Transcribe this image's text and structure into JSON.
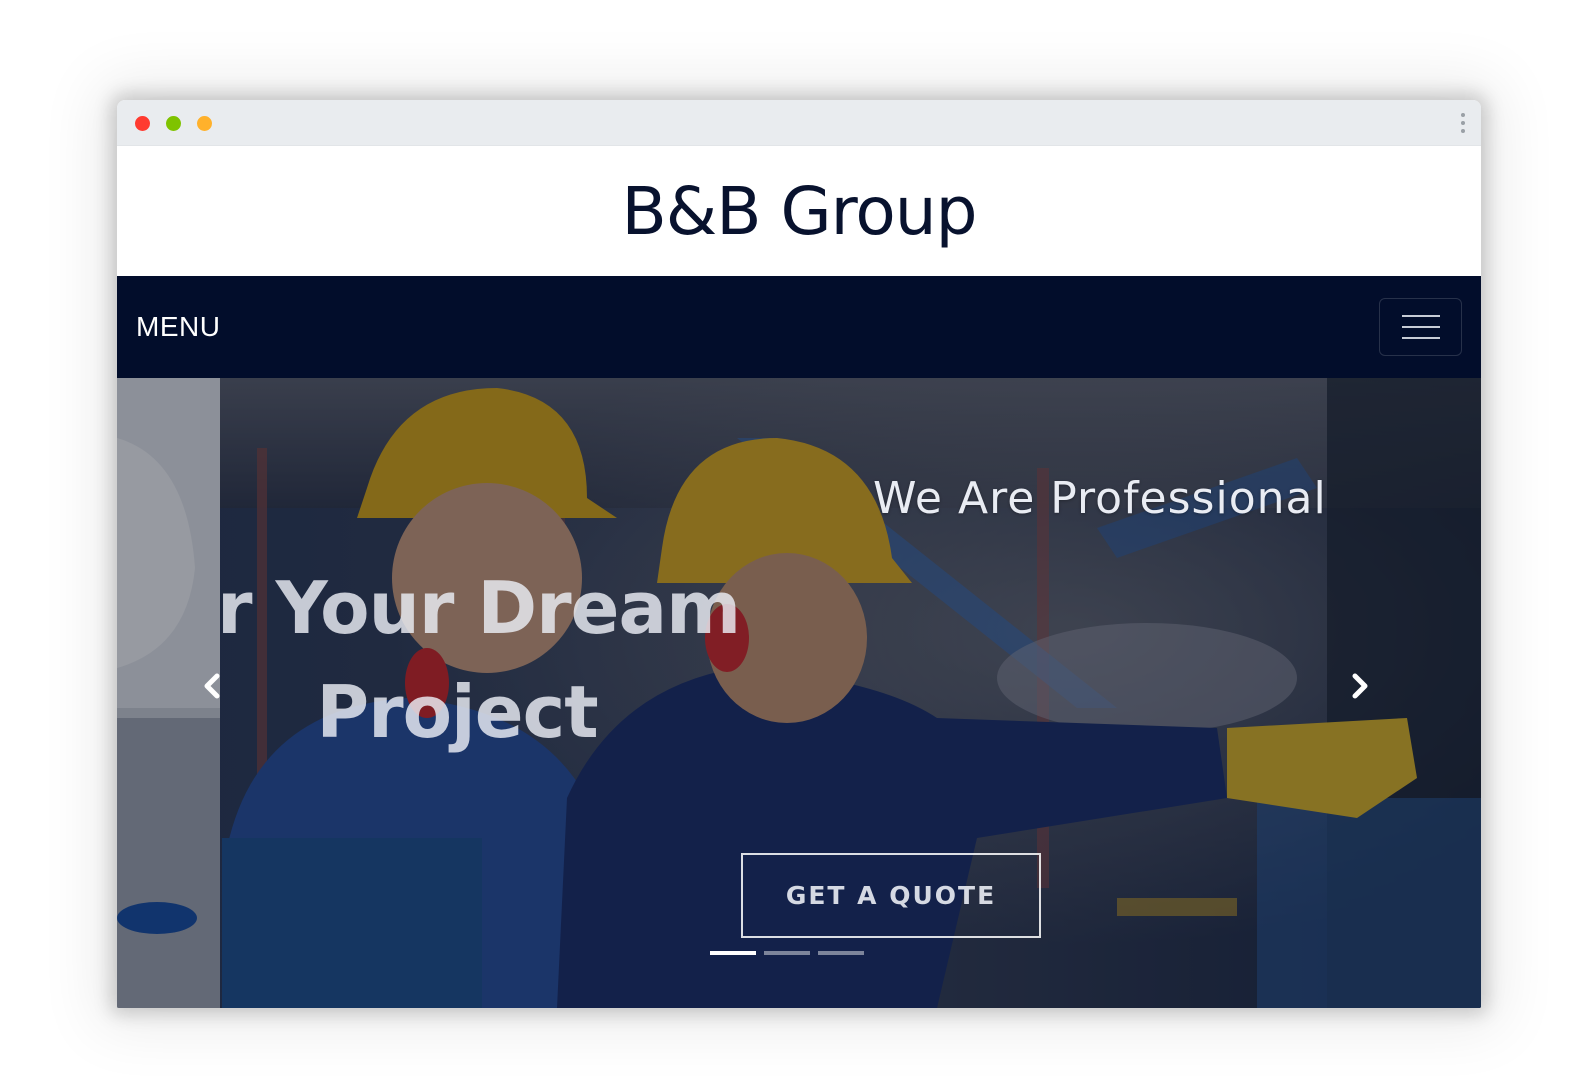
{
  "window": {
    "traffic_lights": {
      "close": "#ff3b30",
      "minimize": "#7fc300",
      "maximize": "#ffb12b"
    },
    "menu_icon": "kebab-icon"
  },
  "header": {
    "brand": "B&B Group",
    "brand_color": "#08122e"
  },
  "navbar": {
    "menu_label": "MENU",
    "toggle_icon": "hamburger-icon",
    "background": "#020d2b"
  },
  "hero": {
    "subtitle": "We Are Professional",
    "title_line1": "r Your Dream",
    "title_line2": "Project",
    "cta_label": "GET A QUOTE",
    "prev_icon": "chevron-left-icon",
    "next_icon": "chevron-right-icon",
    "slides_total": 3,
    "active_slide": 1
  }
}
